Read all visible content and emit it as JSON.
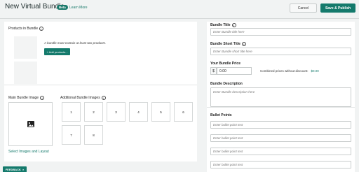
{
  "header": {
    "title": "New Virtual Bundle",
    "beta_badge": "Beta",
    "learn_more": "Learn More",
    "cancel_label": "Cancel",
    "save_label": "Save & Publish"
  },
  "products": {
    "label": "Products in Bundle",
    "note": "A bundle must contain at least two products.",
    "add_button": "+ Add products..."
  },
  "main_image": {
    "label": "Main Bundle Image",
    "select_link": "Select Images and Layout"
  },
  "additional_images": {
    "label": "Additional Bundle Images",
    "slots": [
      "1",
      "2",
      "3",
      "4",
      "5",
      "6",
      "7",
      "8"
    ]
  },
  "form": {
    "title_label": "Bundle Title",
    "title_placeholder": "Enter Bundle title here",
    "short_title_label": "Bundle Short Title",
    "short_title_placeholder": "Enter Bundle short title here",
    "price_label": "Your Bundle Price",
    "price_prefix": "$",
    "price_value": "0.00",
    "combined_label": "Combined prices without discount:",
    "combined_value": "$0.00",
    "description_label": "Bundle Description",
    "description_placeholder": "Enter Bundle description here",
    "bullets_label": "Bullet Points",
    "bullet_placeholder": "Enter bullet point text"
  },
  "feedback": {
    "label": "FEEDBACK",
    "close": "×"
  },
  "colors": {
    "accent": "#147a6c",
    "background": "#f1f3f3"
  }
}
